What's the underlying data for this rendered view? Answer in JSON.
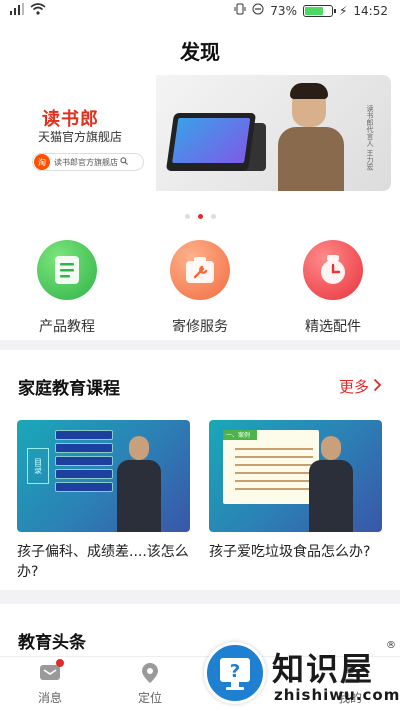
{
  "statusbar": {
    "battery": "73%",
    "time": "14:52",
    "battery_level": 0.73
  },
  "header": {
    "title": "发现"
  },
  "banner": {
    "brand": "读书郎",
    "store": "天猫官方旗舰店",
    "search_tag": "淘",
    "search_text": "读书郎官方旗舰店",
    "signature": "读书郎代言人 王力宏",
    "active_dot": 2,
    "dot_count": 3
  },
  "quick_links": [
    {
      "label": "产品教程",
      "icon": "document-icon"
    },
    {
      "label": "寄修服务",
      "icon": "wrench-icon"
    },
    {
      "label": "精选配件",
      "icon": "clock-icon"
    }
  ],
  "courses": {
    "title": "家庭教育课程",
    "more": "更多",
    "items": [
      {
        "title": "孩子偏科、成绩差....该怎么办?",
        "thumb_tag": "目录",
        "chapters": [
          "01 案例",
          "02 问题表现",
          "03 分析原因",
          "04 解决对策",
          "05 技巧"
        ]
      },
      {
        "title": "孩子爱吃垃圾食品怎么办?",
        "thumb_tag": "一、案例"
      }
    ]
  },
  "news": {
    "title": "教育头条"
  },
  "tabbar": {
    "items": [
      {
        "label": "消息",
        "icon": "message-icon",
        "badge": true
      },
      {
        "label": "定位",
        "icon": "location-icon"
      },
      {
        "label": "我的",
        "icon": "user-icon"
      }
    ]
  },
  "watermark": {
    "text": "知识屋",
    "reg": "®",
    "sub": "zhishiwu.com"
  }
}
